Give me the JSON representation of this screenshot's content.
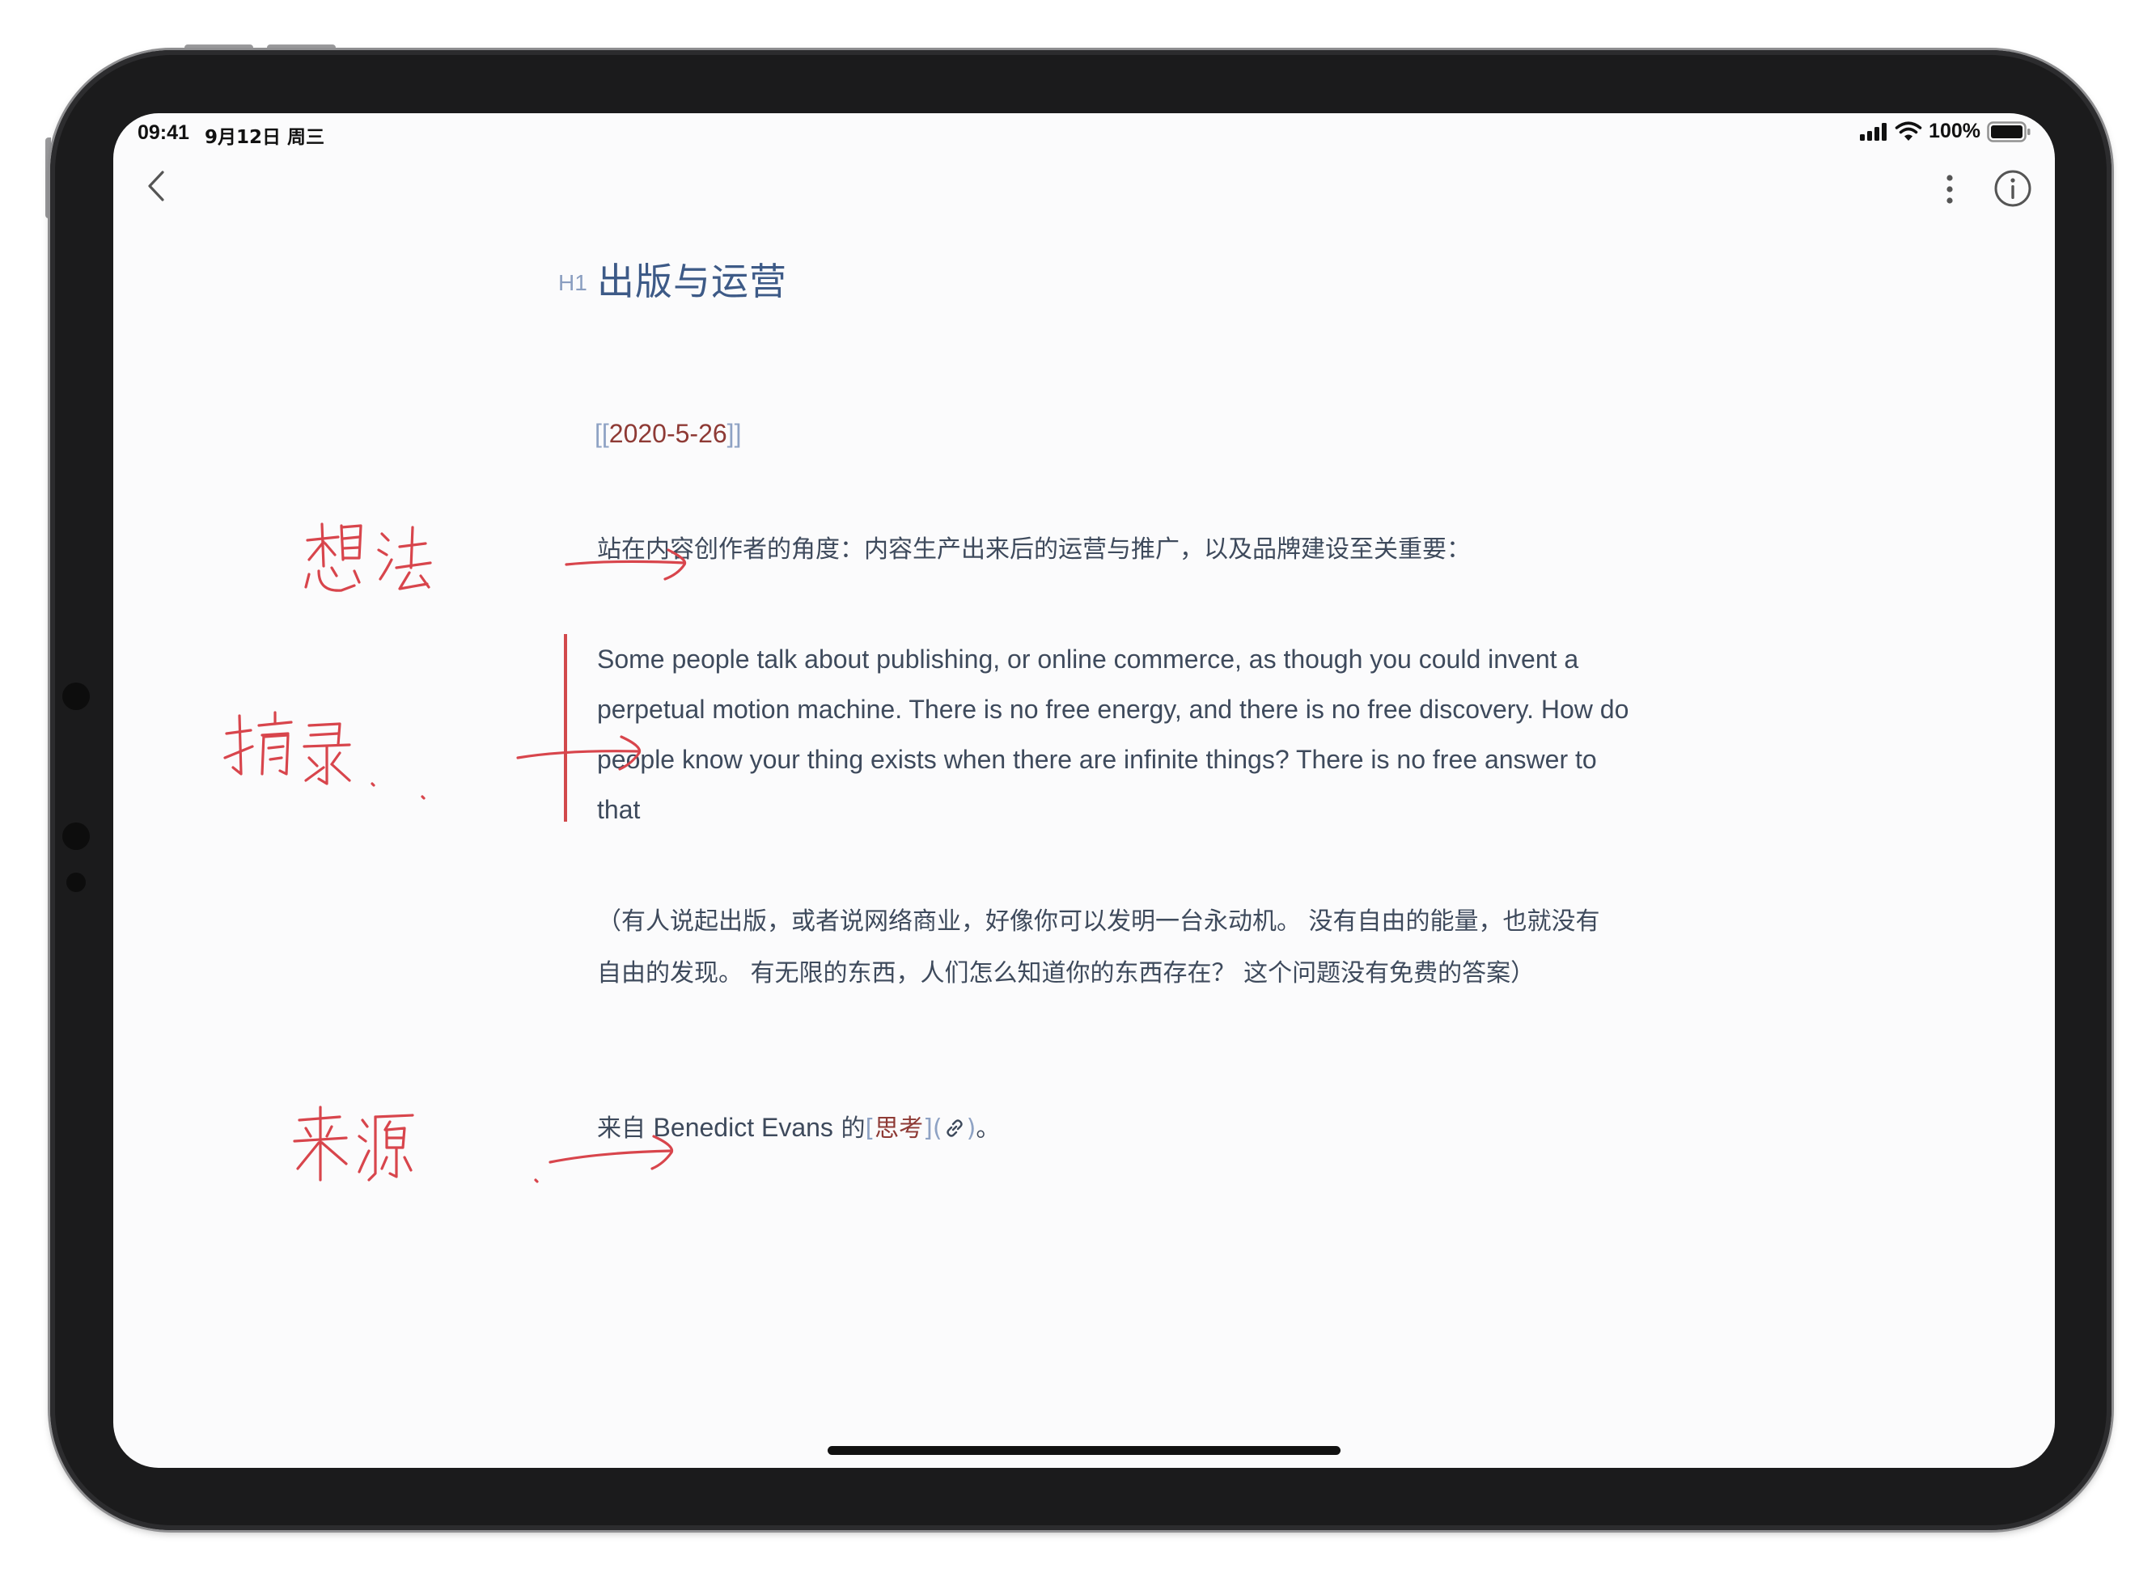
{
  "status_bar": {
    "time": "09:41",
    "date": "9月12日 周三",
    "battery": "100%"
  },
  "nav": {
    "back_icon": "chevron-left-icon",
    "more_icon": "more-vertical-icon",
    "info_icon": "info-circle-icon"
  },
  "note": {
    "heading_marker": "H1",
    "title": "出版与运营",
    "daily_link": {
      "open": "[[",
      "text": "2020-5-26",
      "close": "]]"
    },
    "thought": "站在内容创作者的角度：内容生产出来后的运营与推广，以及品牌建设至关重要：",
    "quote": "Some people talk about publishing, or online commerce, as though you could invent a perpetual motion machine. There is no free energy, and there is no free discovery. How do people know your thing exists when there are infinite things? There is no free answer to that",
    "translation": "（有人说起出版，或者说网络商业，好像你可以发明一台永动机。 没有自由的能量，也就没有自由的发现。 有无限的东西，人们怎么知道你的东西存在？ 这个问题没有免费的答案）",
    "source": {
      "prefix": "来自 ",
      "author": "Benedict Evans",
      "particle": " 的",
      "link_open": "[",
      "link_text": "思考",
      "link_close": "]",
      "paren_open": "(",
      "paren_close": ")",
      "suffix": "。",
      "link_icon": "link-icon"
    }
  },
  "annotations": {
    "thought_label": "想法",
    "quote_label": "摘录",
    "source_label": "来源",
    "ink_color": "#d8454c"
  },
  "colors": {
    "title": "#3d5a87",
    "link": "#8e3a35",
    "bracket": "#8ea2c4",
    "body": "#3e4a5c",
    "quote_bar": "#d2494c"
  }
}
